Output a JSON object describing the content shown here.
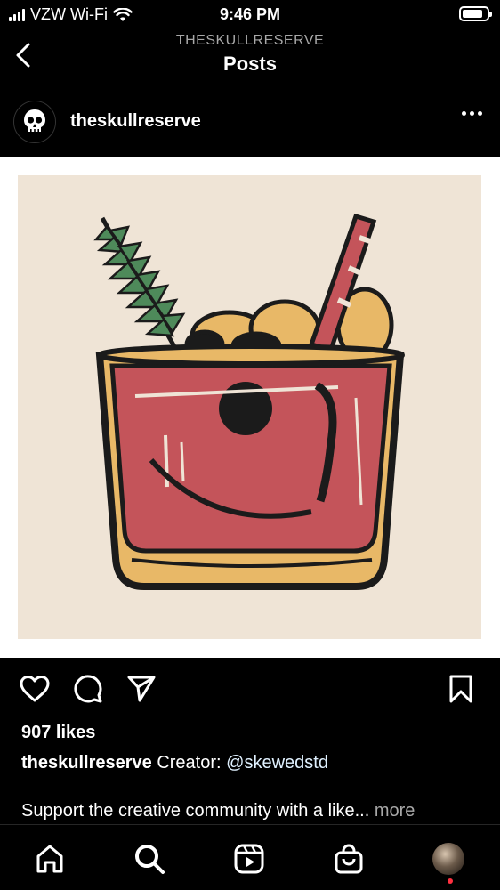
{
  "status_bar": {
    "carrier": "VZW Wi-Fi",
    "time": "9:46 PM",
    "battery_level": 0.85,
    "icons": [
      "signal-icon",
      "wifi-icon",
      "battery-icon"
    ]
  },
  "header": {
    "subtitle": "THESKULLRESERVE",
    "title": "Posts",
    "back_icon": "chevron-left-icon"
  },
  "post": {
    "username": "theskullreserve",
    "avatar_icon": "skull-icon",
    "more_icon": "more-horizontal-icon",
    "image_subject": "cocktail-illustration",
    "likes": "907 likes",
    "caption_user": "theskullreserve",
    "caption_text": "Creator:",
    "caption_mention": "@skewedstd",
    "promo_text": "Support the creative community with a like...",
    "promo_more": "more"
  },
  "actions": {
    "icons": [
      "heart-icon",
      "comment-icon",
      "share-icon",
      "bookmark-icon"
    ]
  },
  "tab_bar": {
    "icons": [
      "home-icon",
      "search-icon",
      "reels-icon",
      "shop-icon",
      "profile-avatar"
    ]
  },
  "colors": {
    "background": "#000000",
    "divider": "#262626",
    "secondary_text": "#a8a8a8",
    "mention": "#e0f1ff",
    "notification": "#ff3040",
    "art_background": "#efe4d6",
    "drink_red": "#c4545a",
    "rim_gold": "#e8b867",
    "garnish_green": "#4e8a5a"
  }
}
